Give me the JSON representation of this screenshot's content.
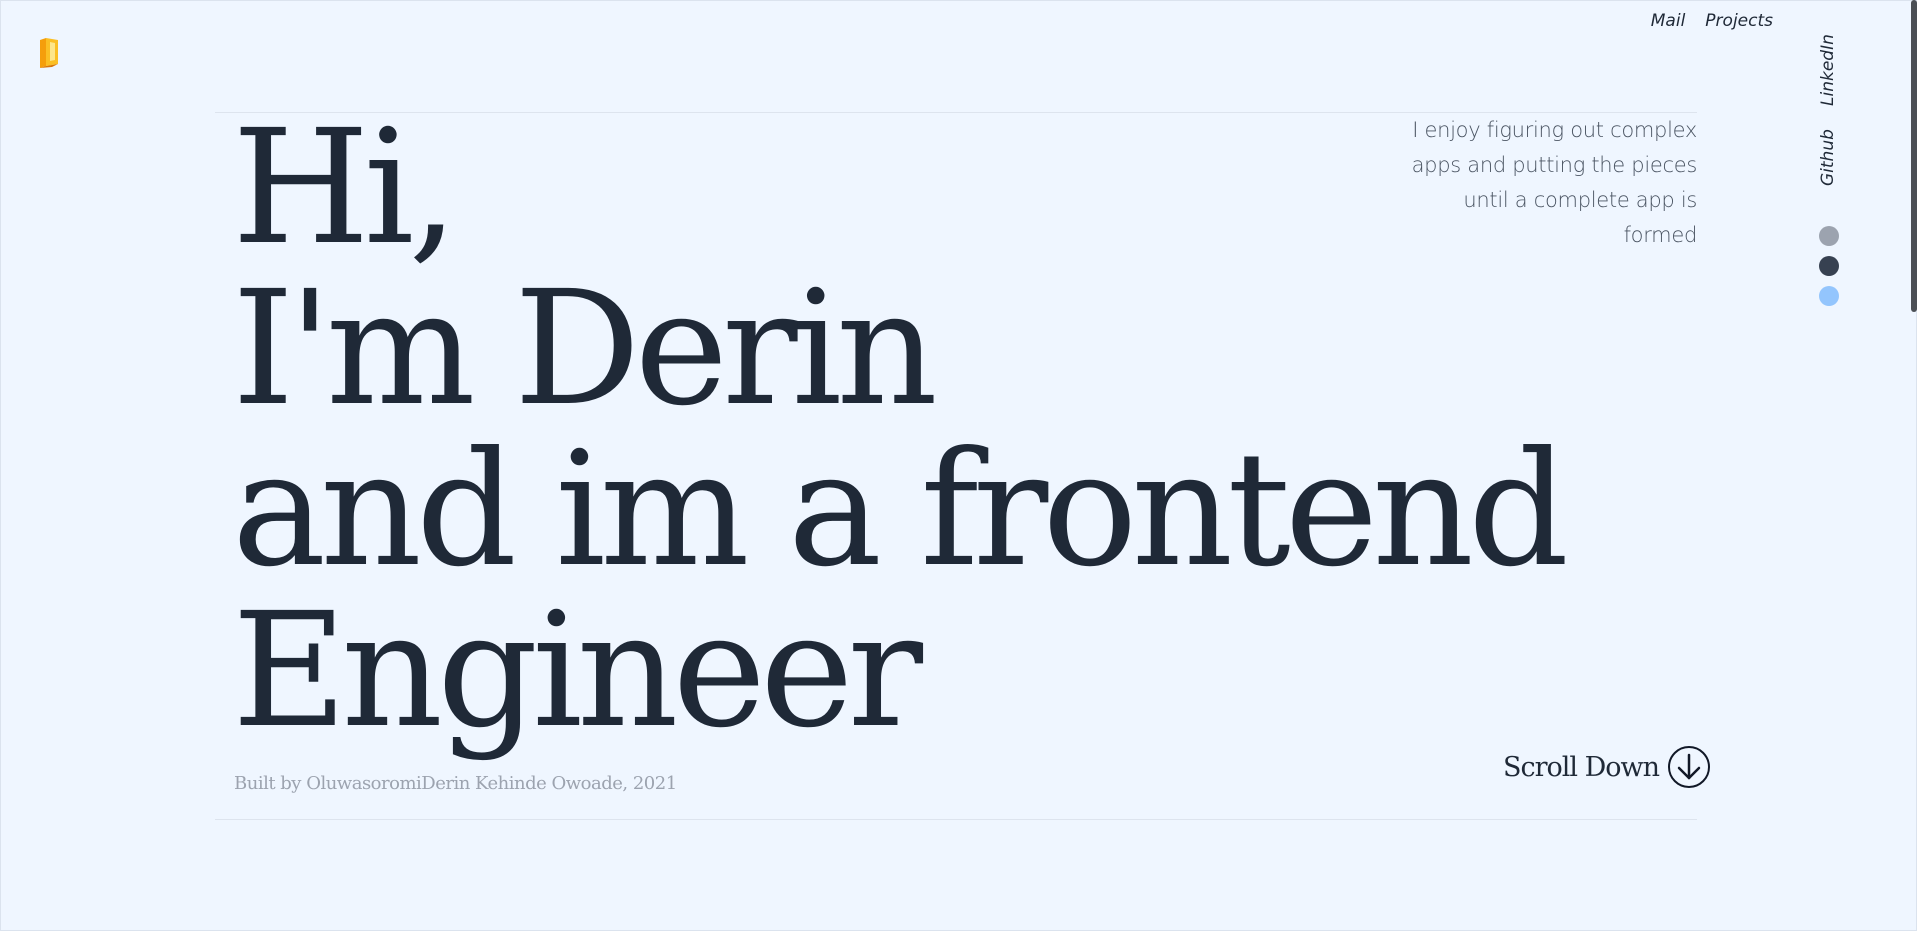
{
  "nav": {
    "mail_label": "Mail",
    "projects_label": "Projects"
  },
  "logo": {
    "icon": "golden-pillar-logo-icon",
    "colors": [
      "#fbbf24",
      "#f59e0b",
      "#d97706"
    ]
  },
  "hero": {
    "lines": [
      "Hi,",
      "I'm Derin",
      "and im a frontend",
      "Engineer"
    ],
    "tagline": "I enjoy figuring out complex apps and putting the pieces until a complete app is formed",
    "credit": "Built by OluwasoromiDerin Kehinde Owoade, 2021",
    "scroll_label": "Scroll Down",
    "scroll_icon": "arrow-down-circle-icon"
  },
  "social": {
    "linkedin_label": "LinkedIn",
    "github_label": "Github"
  },
  "theme": {
    "swatches": [
      {
        "name": "gray",
        "color": "#9ca3af"
      },
      {
        "name": "dark",
        "color": "#374151"
      },
      {
        "name": "blue",
        "color": "#93c5fd"
      }
    ]
  },
  "colors": {
    "background": "#eff6ff",
    "text": "#1f2937",
    "muted": "#9ca3af"
  }
}
